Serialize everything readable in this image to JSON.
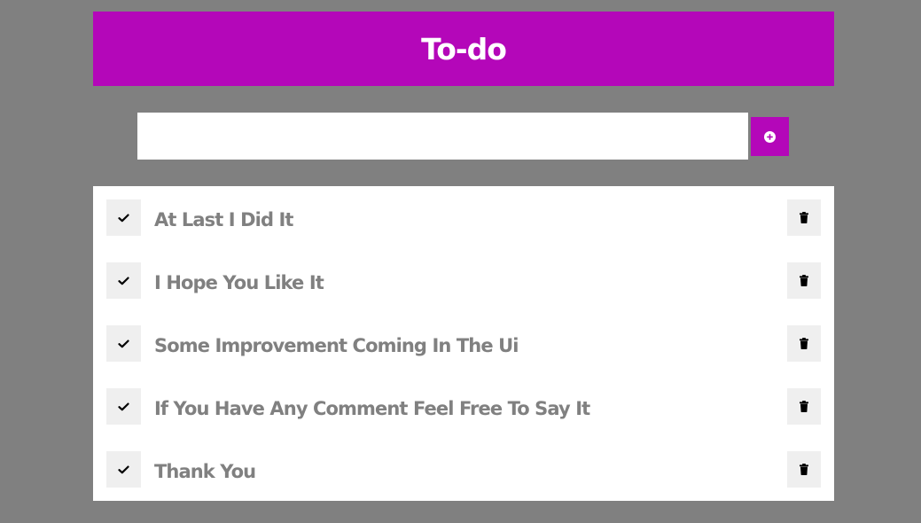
{
  "app": {
    "title": "To-do"
  },
  "new_todo": {
    "value": "",
    "placeholder": "",
    "add_icon": "plus-circle-icon"
  },
  "todos": [
    {
      "text": "At Last I Did It",
      "check_icon": "check-icon",
      "delete_icon": "trash-icon"
    },
    {
      "text": "I Hope You Like It",
      "check_icon": "check-icon",
      "delete_icon": "trash-icon"
    },
    {
      "text": "Some Improvement Coming In The Ui",
      "check_icon": "check-icon",
      "delete_icon": "trash-icon"
    },
    {
      "text": "If You Have Any Comment Feel Free To Say It",
      "check_icon": "check-icon",
      "delete_icon": "trash-icon"
    },
    {
      "text": "Thank You",
      "check_icon": "check-icon",
      "delete_icon": "trash-icon"
    }
  ],
  "colors": {
    "background": "#808080",
    "accent": "#b407b9",
    "surface": "#ffffff",
    "button_bg": "#efefef",
    "item_text": "#808080"
  }
}
